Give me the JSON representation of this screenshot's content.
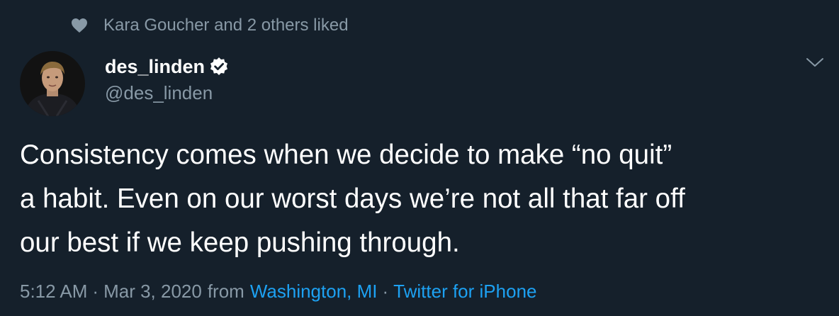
{
  "social_context": {
    "icon": "heart-icon",
    "text": "Kara Goucher and 2 others liked"
  },
  "author": {
    "display_name": "des_linden",
    "verified_icon": "verified-badge-icon",
    "handle": "@des_linden"
  },
  "tweet": {
    "lines": [
      "Consistency comes when we decide to make “no quit”",
      "a habit. Even on our worst days we’re not all that far off",
      "our best if we keep pushing through."
    ]
  },
  "meta": {
    "time": "5:12 AM",
    "date": "Mar 3, 2020",
    "from_label": "from",
    "location": "Washington, MI",
    "separator": "·",
    "source": "Twitter for iPhone"
  },
  "colors": {
    "background": "#15202b",
    "primary_text": "#ffffff",
    "secondary_text": "#8899a6",
    "link": "#1da1f2"
  }
}
